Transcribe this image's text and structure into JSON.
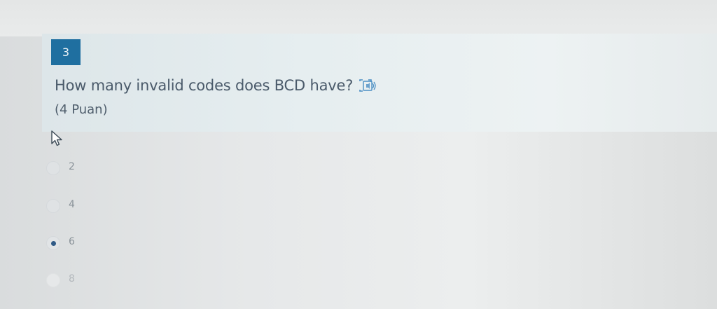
{
  "question": {
    "number": "3",
    "text": "How many invalid codes does BCD have?",
    "points": "(4 Puan)"
  },
  "icons": {
    "translate": "translate-speaker-icon",
    "cursor": "mouse-pointer-icon"
  },
  "options": [
    {
      "label": "2",
      "selected": false
    },
    {
      "label": "4",
      "selected": false
    },
    {
      "label": "6",
      "selected": true
    },
    {
      "label": "8",
      "selected": false
    }
  ],
  "colors": {
    "number_badge": "#1f6fa0",
    "question_text": "#4a5a6a",
    "selected_dot": "#2f5a86"
  }
}
